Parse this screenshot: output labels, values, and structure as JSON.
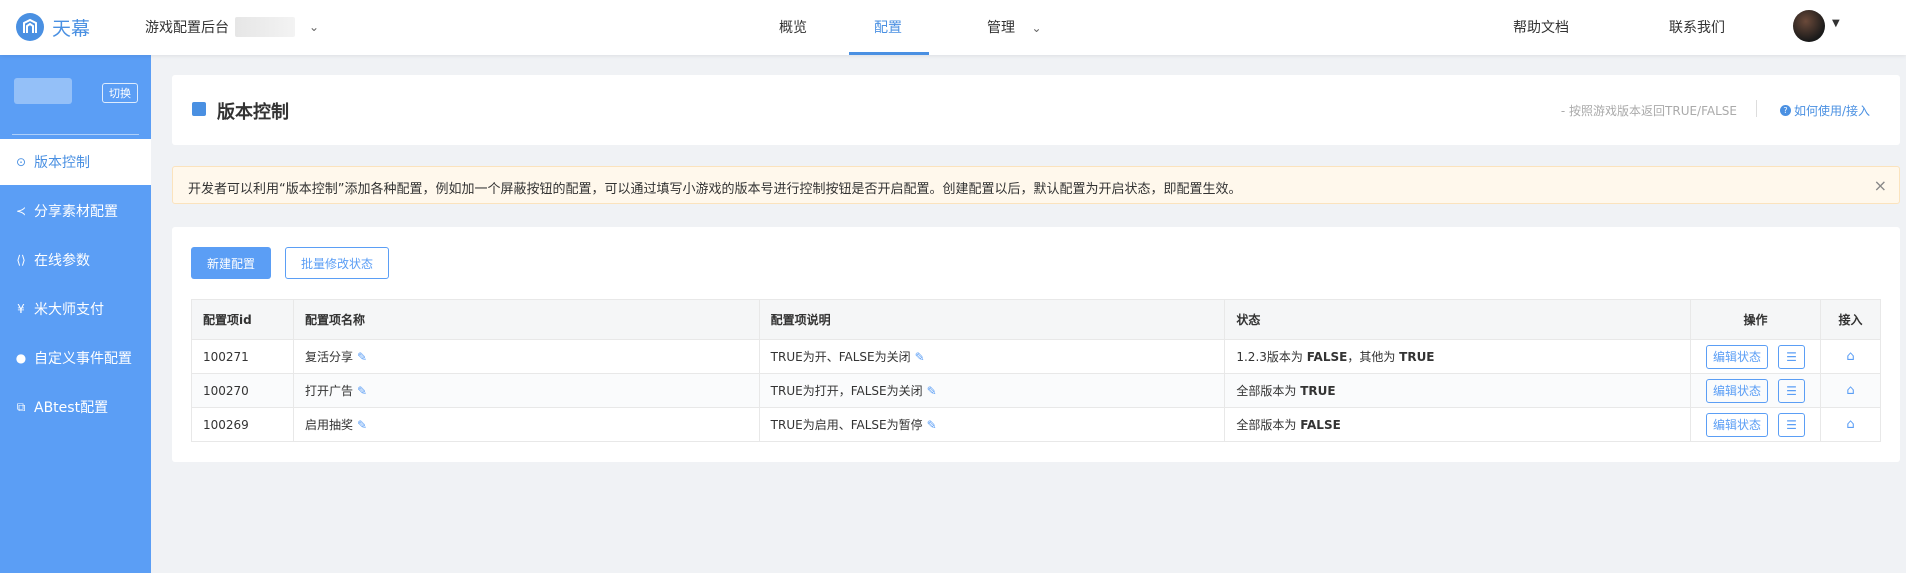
{
  "brand": {
    "name": "天幕",
    "color": "#4a90e2"
  },
  "header": {
    "app_label": "游戏配置后台",
    "nav": [
      {
        "label": "概览"
      },
      {
        "label": "配置",
        "active": true
      },
      {
        "label": "管理"
      }
    ],
    "links": [
      "帮助文档",
      "联系我们"
    ]
  },
  "sidebar": {
    "switch_label": "切换",
    "items": [
      {
        "label": "版本控制",
        "icon": "check-circle-icon",
        "active": true
      },
      {
        "label": "分享素材配置",
        "icon": "share-icon"
      },
      {
        "label": "在线参数",
        "icon": "code-icon"
      },
      {
        "label": "米大师支付",
        "icon": "yen-icon"
      },
      {
        "label": "自定义事件配置",
        "icon": "event-icon"
      },
      {
        "label": "ABtest配置",
        "icon": "copy-icon"
      }
    ]
  },
  "page": {
    "title": "版本控制",
    "hint": "- 按照游戏版本返回TRUE/FALSE",
    "help_link": "如何使用/接入"
  },
  "notice": {
    "text": "开发者可以利用“版本控制”添加各种配置，例如加一个屏蔽按钮的配置，可以通过填写小游戏的版本号进行控制按钮是否开启配置。创建配置以后，默认配置为开启状态，即配置生效。"
  },
  "toolbar": {
    "new_label": "新建配置",
    "batch_label": "批量修改状态"
  },
  "table": {
    "headers": [
      "配置项id",
      "配置项名称",
      "配置项说明",
      "状态",
      "操作",
      "接入"
    ],
    "edit_status_label": "编辑状态",
    "rows": [
      {
        "id": "100271",
        "name": "复活分享",
        "desc": "TRUE为开、FALSE为关闭",
        "status_prefix": "1.2.3版本为 ",
        "status_value": "FALSE",
        "status_mid": "，其他为 ",
        "status_value2": "TRUE"
      },
      {
        "id": "100270",
        "name": "打开广告",
        "desc": "TRUE为打开，FALSE为关闭",
        "status_prefix": "全部版本为 ",
        "status_value": "TRUE",
        "status_mid": "",
        "status_value2": ""
      },
      {
        "id": "100269",
        "name": "启用抽奖",
        "desc": "TRUE为启用、FALSE为暂停",
        "status_prefix": "全部版本为 ",
        "status_value": "FALSE",
        "status_mid": "",
        "status_value2": ""
      }
    ]
  }
}
